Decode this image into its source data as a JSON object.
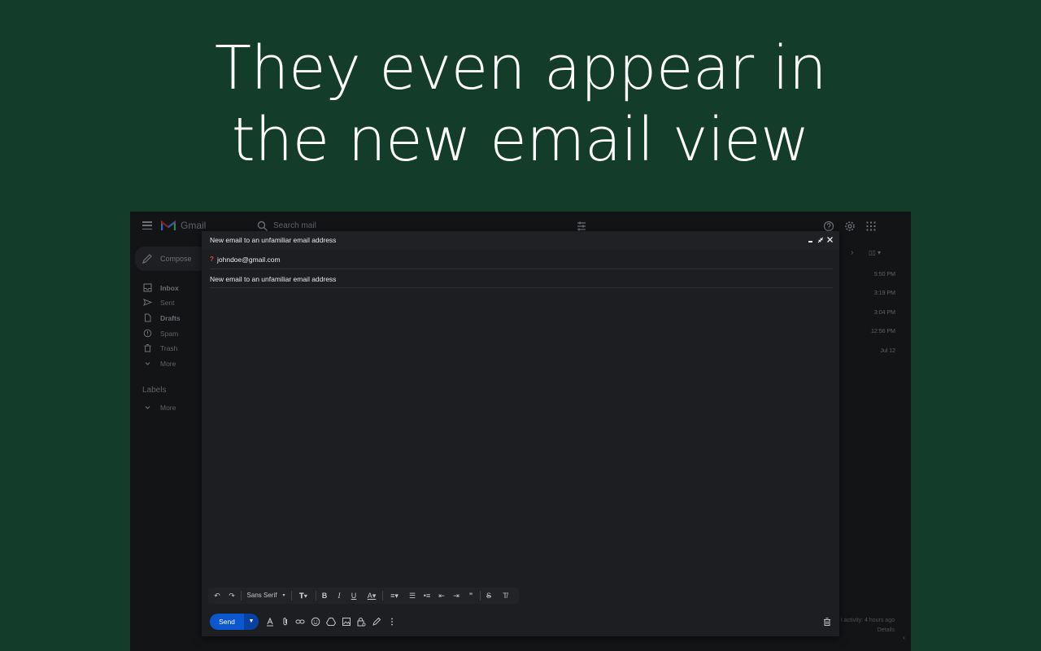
{
  "headline": {
    "line1": "They even appear in",
    "line2": "the new email view"
  },
  "gmail": {
    "product_name": "Gmail",
    "search_placeholder": "Search mail",
    "compose_label": "Compose",
    "nav": [
      {
        "label": "Inbox",
        "icon": "inbox-icon",
        "bold": true
      },
      {
        "label": "Sent",
        "icon": "sent-icon",
        "bold": false
      },
      {
        "label": "Drafts",
        "icon": "drafts-icon",
        "bold": true
      },
      {
        "label": "Spam",
        "icon": "spam-icon",
        "bold": false
      },
      {
        "label": "Trash",
        "icon": "trash-icon",
        "bold": false
      },
      {
        "label": "More",
        "icon": "chevron-down-icon",
        "bold": false
      }
    ],
    "labels_heading": "Labels",
    "labels_more": "More",
    "times": [
      "5:50 PM",
      "3:19 PM",
      "3:04 PM",
      "12:56 PM",
      "Jul 12"
    ],
    "last_activity": "t activity: 4 hours ago",
    "details": "Details"
  },
  "compose": {
    "title": "New email to an unfamiliar email address",
    "to_warning": "?",
    "to": "johndoe@gmail.com",
    "subject": "New email to an unfamiliar email address",
    "font_name": "Sans Serif",
    "send_label": "Send"
  },
  "colors": {
    "background": "#133d2a",
    "send_button": "#0b57d0",
    "warning": "#e04a3f"
  }
}
